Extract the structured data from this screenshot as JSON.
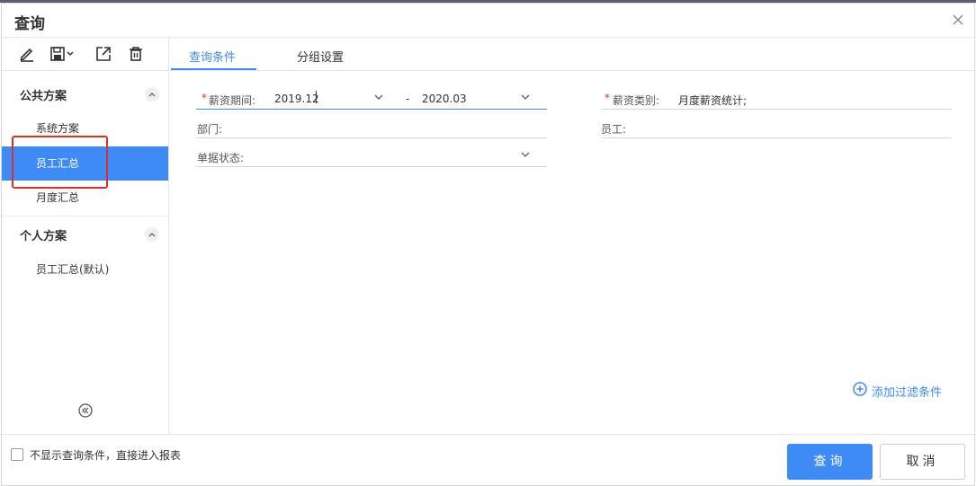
{
  "dialog": {
    "title": "查询",
    "close_icon": "close-icon"
  },
  "toolbar": {
    "icons": [
      "edit-icon",
      "save-icon",
      "export-icon",
      "delete-icon"
    ]
  },
  "sidebar": {
    "public_group": {
      "title": "公共方案",
      "items": [
        "系统方案",
        "员工汇总",
        "月度汇总"
      ],
      "active_index": 1
    },
    "personal_group": {
      "title": "个人方案",
      "items": [
        "员工汇总(默认)"
      ]
    }
  },
  "tabs": {
    "items": [
      "查询条件",
      "分组设置"
    ],
    "active_index": 0
  },
  "form": {
    "salary_period": {
      "label": "薪资期间:",
      "required_mark": "*",
      "from": "2019.12",
      "separator": "-",
      "to": "2020.03"
    },
    "salary_category": {
      "label": "薪资类别:",
      "required_mark": "*",
      "value": "月度薪资统计;"
    },
    "department": {
      "label": "部门:"
    },
    "employee": {
      "label": "员工:"
    },
    "doc_status": {
      "label": "单据状态:"
    }
  },
  "add_filter": {
    "label": "添加过滤条件",
    "icon": "plus-circle-icon"
  },
  "footer": {
    "checkbox_label": "不显示查询条件，直接进入报表",
    "checkbox_checked": false,
    "query_button": "查询",
    "cancel_button": "取消"
  },
  "colors": {
    "accent": "#3f8bf5",
    "required": "#e0302a",
    "highlight_box": "#d9302a"
  }
}
